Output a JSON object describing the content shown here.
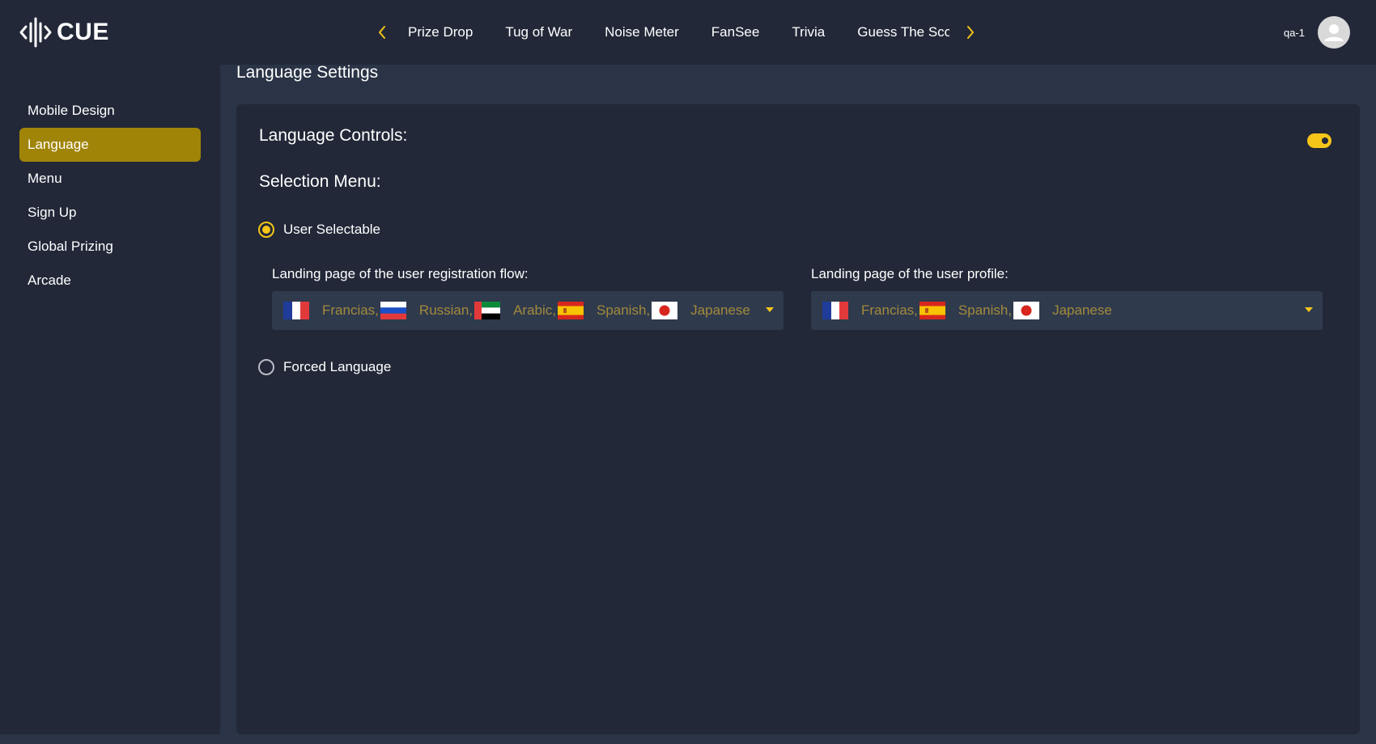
{
  "brand": {
    "name": "CUE",
    "accent": "#f5c518"
  },
  "tabs": [
    "Prize Drop",
    "Tug of War",
    "Noise Meter",
    "FanSee",
    "Trivia",
    "Guess The Sco"
  ],
  "user": {
    "name": "qa-1"
  },
  "sidebar": {
    "items": [
      {
        "label": "Mobile Design"
      },
      {
        "label": "Language",
        "active": true
      },
      {
        "label": "Menu"
      },
      {
        "label": "Sign Up"
      },
      {
        "label": "Global Prizing"
      },
      {
        "label": "Arcade"
      }
    ],
    "active_color": "#a08408"
  },
  "page": {
    "title": "Language Settings",
    "language_controls_label": "Language Controls:",
    "language_controls_enabled": true,
    "selection_menu_label": "Selection Menu:",
    "options": {
      "user_selectable": {
        "label": "User Selectable",
        "selected": true
      },
      "forced_language": {
        "label": "Forced Language",
        "selected": false
      }
    },
    "registration": {
      "label": "Landing page of the user registration flow:",
      "languages": [
        {
          "name": "Francias,",
          "flag": "france-flag-icon"
        },
        {
          "name": "Russian,",
          "flag": "russia-flag-icon"
        },
        {
          "name": "Arabic,",
          "flag": "uae-flag-icon"
        },
        {
          "name": "Spanish,",
          "flag": "spain-flag-icon"
        },
        {
          "name": "Japanese",
          "flag": "japan-flag-icon"
        }
      ]
    },
    "profile": {
      "label": "Landing page of the user profile:",
      "languages": [
        {
          "name": "Francias,",
          "flag": "france-flag-icon"
        },
        {
          "name": "Spanish,",
          "flag": "spain-flag-icon"
        },
        {
          "name": "Japanese",
          "flag": "japan-flag-icon"
        }
      ]
    }
  }
}
